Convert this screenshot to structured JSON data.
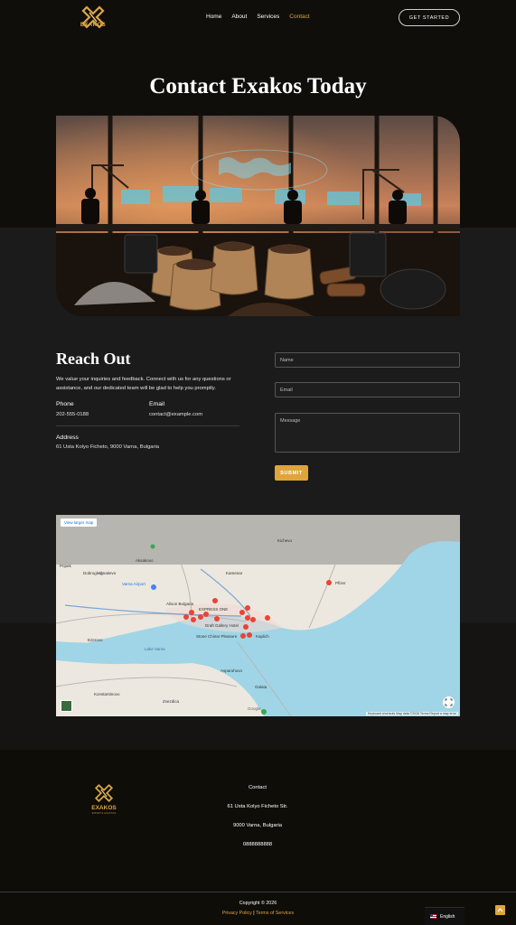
{
  "nav": {
    "logo_text": "EXAKOS",
    "items": [
      {
        "label": "Home",
        "active": false
      },
      {
        "label": "About",
        "active": false
      },
      {
        "label": "Services",
        "active": false
      },
      {
        "label": "Contact",
        "active": true
      }
    ],
    "cta_label": "GET STARTED"
  },
  "hero": {
    "title": "Contact Exakos Today"
  },
  "contact": {
    "heading": "Reach Out",
    "description": "We value your inquiries and feedback. Connect with us for any questions or assistance, and our dedicated team will be glad to help you promptly.",
    "phone_label": "Phone",
    "phone_value": "202-555-0188",
    "email_label": "Email",
    "email_value": "contact@example.com",
    "address_label": "Address",
    "address_value": "61 Usta Kolyo Ficheto, 9000 Varna, Bulgaria"
  },
  "form": {
    "name_placeholder": "Name",
    "email_placeholder": "Email",
    "message_placeholder": "Message",
    "submit_label": "SUBMIT"
  },
  "map": {
    "view_larger": "View larger map",
    "footer_text": "Keyboard shortcuts   Map data ©2026   Terms   Report a map error",
    "labels": [
      {
        "text": "Kichevo"
      },
      {
        "text": "Dobrogled"
      },
      {
        "text": "Aksakovo"
      },
      {
        "text": "Kamenar"
      },
      {
        "text": "Pripek"
      },
      {
        "text": "Ignatievo"
      },
      {
        "text": "Varna Airport"
      },
      {
        "text": "Alison Bulgaria"
      },
      {
        "text": "EXPRESS ONE"
      },
      {
        "text": "Draft Gallery Hotel"
      },
      {
        "text": "Stone Chinar Pleasure"
      },
      {
        "text": "Kaplich"
      },
      {
        "text": "Pfizer"
      },
      {
        "text": "Ezerovo"
      },
      {
        "text": "Lake Varna"
      },
      {
        "text": "Konstantinovo"
      },
      {
        "text": "Zvezdica"
      },
      {
        "text": "Asparuhovo"
      },
      {
        "text": "Galata"
      },
      {
        "text": "Google"
      }
    ]
  },
  "footer": {
    "logo_text": "EXAKOS",
    "tagline": "EXPORT & LOGISTICS",
    "contact_heading": "Contact",
    "street": "61 Usta Kolyo Ficheto Str.",
    "city": "9000 Varna, Bulgaria",
    "phone": "0888888888",
    "copyright": "Copyright © 2026",
    "privacy": "Privacy Policy",
    "separator": "|",
    "terms": "Terms of Services",
    "language": "English"
  },
  "colors": {
    "accent": "#dfa53c",
    "dark_bg": "#100e0a",
    "body_bg": "#1b1b1b",
    "sea": "#9fd5e6"
  },
  "icons": [
    "exakos-logo-icon",
    "map-fullscreen-icon",
    "flag-us-icon",
    "arrow-up-icon"
  ]
}
